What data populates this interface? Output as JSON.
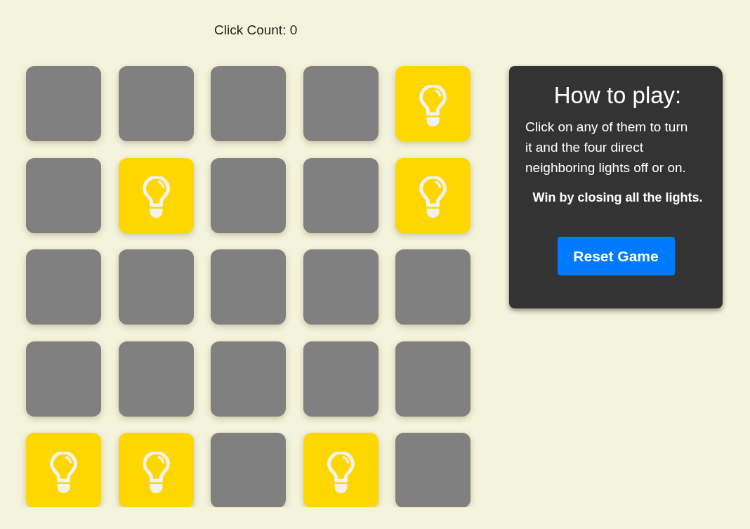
{
  "click_count": "Click Count: 0",
  "grid": {
    "rows": [
      [
        {
          "on": false
        },
        {
          "on": false
        },
        {
          "on": false
        },
        {
          "on": false
        },
        {
          "on": true
        }
      ],
      [
        {
          "on": false
        },
        {
          "on": true
        },
        {
          "on": false
        },
        {
          "on": false
        },
        {
          "on": true
        }
      ],
      [
        {
          "on": false
        },
        {
          "on": false
        },
        {
          "on": false
        },
        {
          "on": false
        },
        {
          "on": false
        }
      ],
      [
        {
          "on": false
        },
        {
          "on": false
        },
        {
          "on": false
        },
        {
          "on": false
        },
        {
          "on": false
        }
      ],
      [
        {
          "on": true
        },
        {
          "on": true
        },
        {
          "on": false
        },
        {
          "on": true
        },
        {
          "on": false
        }
      ]
    ]
  },
  "help_panel": {
    "title": "How to play:",
    "instructions": "Click on any of them to turn it and the four direct neighboring lights off or on.",
    "goal": "Win by closing all the lights.",
    "button": "Reset Game"
  }
}
